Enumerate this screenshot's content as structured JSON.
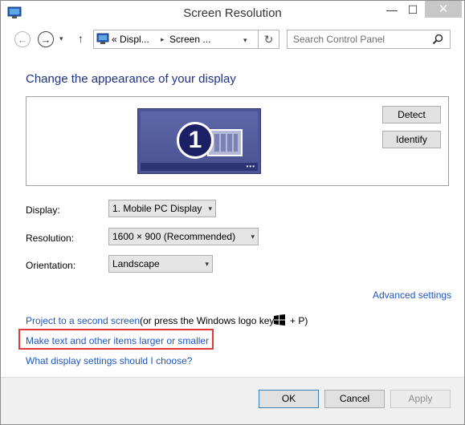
{
  "window": {
    "title": "Screen Resolution",
    "controls": {
      "minimize": "—",
      "maximize": "☐",
      "close": "✕"
    }
  },
  "nav": {
    "back": "←",
    "forward": "→",
    "recent": "▾",
    "up": "↑",
    "address": {
      "prefix": "«",
      "segment1": "Displ...",
      "separator": "▸",
      "segment2": "Screen ...",
      "dropdown": "▾"
    },
    "refresh": "↻",
    "search_placeholder": "Search Control Panel"
  },
  "content": {
    "heading": "Change the appearance of your display",
    "monitor_number": "1",
    "detect": "Detect",
    "identify": "Identify",
    "display_label": "Display:",
    "display_value": "1. Mobile PC Display",
    "resolution_label": "Resolution:",
    "resolution_value": "1600 × 900 (Recommended)",
    "orientation_label": "Orientation:",
    "orientation_value": "Landscape",
    "advanced": "Advanced settings",
    "project_link": "Project to a second screen",
    "project_note_1": "(or press the Windows logo key",
    "project_note_2": "+ P)",
    "text_size_link": "Make text and other items larger or smaller",
    "help_link": "What display settings should I choose?"
  },
  "footer": {
    "ok": "OK",
    "cancel": "Cancel",
    "apply": "Apply"
  }
}
